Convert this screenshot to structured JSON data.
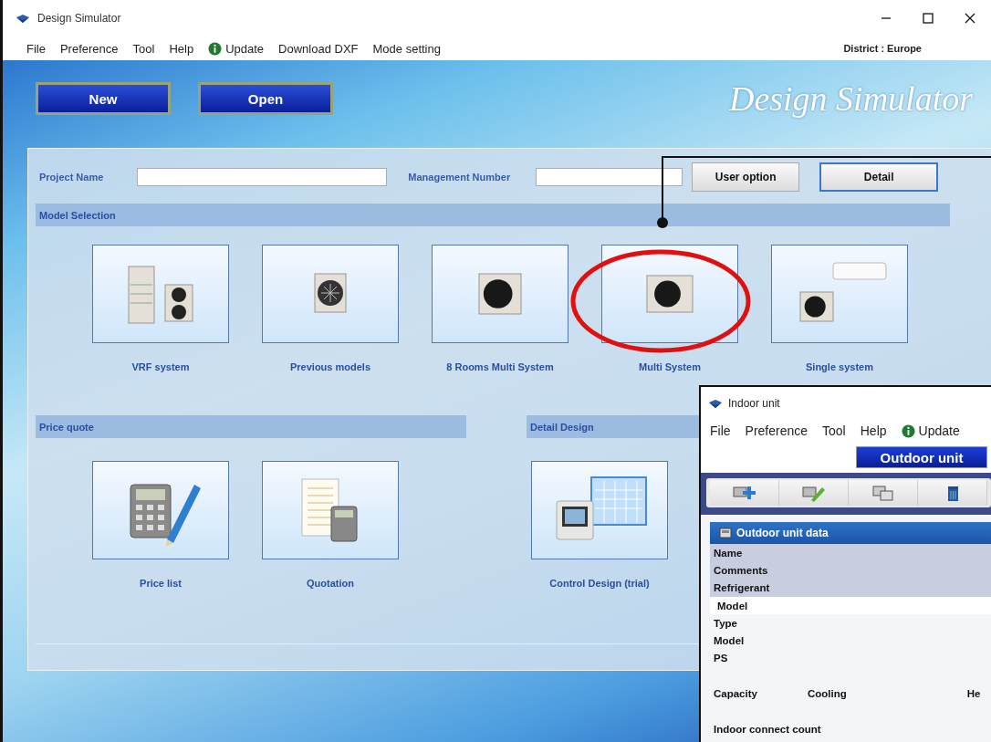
{
  "window": {
    "title": "Design Simulator"
  },
  "menu": [
    {
      "label": "File",
      "kind": "plain"
    },
    {
      "label": "Preference",
      "kind": "plain"
    },
    {
      "label": "Tool",
      "kind": "plain"
    },
    {
      "label": "Help",
      "kind": "plain"
    },
    {
      "label": "Update",
      "kind": "update"
    },
    {
      "label": "Download DXF",
      "kind": "plain"
    },
    {
      "label": "Mode setting",
      "kind": "plain"
    }
  ],
  "district": "District : Europe",
  "actions": [
    "New",
    "Open"
  ],
  "logo": "Design Simulator",
  "project": {
    "fields": [
      {
        "label": "Project Name"
      },
      {
        "label": "Management Number"
      }
    ],
    "buttons": [
      {
        "label": "User option",
        "focused": false
      },
      {
        "label": "Detail",
        "focused": true
      }
    ]
  },
  "model_selection": {
    "title": "Model Selection",
    "items": [
      {
        "label": "VRF system",
        "kind": "vrf"
      },
      {
        "label": "Previous models",
        "kind": "previous"
      },
      {
        "label": "8 Rooms Multi System",
        "kind": "eight"
      },
      {
        "label": "Multi System",
        "kind": "multi"
      },
      {
        "label": "Single system",
        "kind": "single"
      }
    ]
  },
  "price_quote": {
    "title": "Price quote",
    "items": [
      {
        "label": "Price list",
        "kind": "calculator"
      },
      {
        "label": "Quotation",
        "kind": "quotation"
      }
    ]
  },
  "detail_design": {
    "title": "Detail Design",
    "items": [
      {
        "label": "Control Design (trial)",
        "kind": "control"
      }
    ]
  },
  "indoor_window": {
    "title": "Indoor unit",
    "menu": [
      {
        "label": "File",
        "kind": "plain"
      },
      {
        "label": "Preference",
        "kind": "plain"
      },
      {
        "label": "Tool",
        "kind": "plain"
      },
      {
        "label": "Help",
        "kind": "plain"
      },
      {
        "label": "Update",
        "kind": "update"
      }
    ],
    "tab": "Outdoor unit",
    "toolbar": [
      {
        "kind": "add"
      },
      {
        "kind": "edit"
      },
      {
        "kind": "copy"
      },
      {
        "kind": "delete"
      }
    ],
    "section": "Outdoor unit data",
    "rows": [
      {
        "label": "Name",
        "kind": "shaded"
      },
      {
        "label": "Comments",
        "kind": "shaded"
      },
      {
        "label": "Refrigerant",
        "kind": "shaded"
      },
      {
        "label": "Model",
        "kind": "group"
      },
      {
        "label": "Type",
        "kind": "plain"
      },
      {
        "label": "Model",
        "kind": "plain"
      },
      {
        "label": "PS",
        "kind": "plain"
      },
      {
        "label": "Capacity",
        "kind": "spaced",
        "columns": [
          "Cooling",
          "He"
        ]
      },
      {
        "label": "Indoor connect count",
        "kind": "spaced"
      }
    ]
  }
}
